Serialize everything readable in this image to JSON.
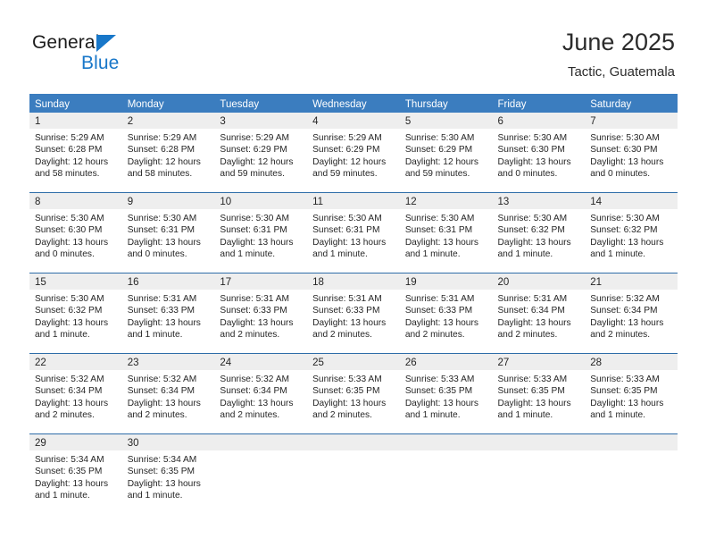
{
  "brand": {
    "name_top": "General",
    "name_bottom": "Blue",
    "triangle_icon": "triangle-logo-icon",
    "accent_color": "#1877c9"
  },
  "header": {
    "title": "June 2025",
    "subtitle": "Tactic, Guatemala"
  },
  "theme": {
    "header_bg": "#3b7dbf",
    "row_separator": "#2e6da8",
    "day_band_bg": "#eeeeee",
    "text_color": "#262626"
  },
  "calendar": {
    "weekday_headers": [
      "Sunday",
      "Monday",
      "Tuesday",
      "Wednesday",
      "Thursday",
      "Friday",
      "Saturday"
    ],
    "weeks": [
      [
        {
          "day": "1",
          "sunrise": "Sunrise: 5:29 AM",
          "sunset": "Sunset: 6:28 PM",
          "daylight_1": "Daylight: 12 hours",
          "daylight_2": "and 58 minutes."
        },
        {
          "day": "2",
          "sunrise": "Sunrise: 5:29 AM",
          "sunset": "Sunset: 6:28 PM",
          "daylight_1": "Daylight: 12 hours",
          "daylight_2": "and 58 minutes."
        },
        {
          "day": "3",
          "sunrise": "Sunrise: 5:29 AM",
          "sunset": "Sunset: 6:29 PM",
          "daylight_1": "Daylight: 12 hours",
          "daylight_2": "and 59 minutes."
        },
        {
          "day": "4",
          "sunrise": "Sunrise: 5:29 AM",
          "sunset": "Sunset: 6:29 PM",
          "daylight_1": "Daylight: 12 hours",
          "daylight_2": "and 59 minutes."
        },
        {
          "day": "5",
          "sunrise": "Sunrise: 5:30 AM",
          "sunset": "Sunset: 6:29 PM",
          "daylight_1": "Daylight: 12 hours",
          "daylight_2": "and 59 minutes."
        },
        {
          "day": "6",
          "sunrise": "Sunrise: 5:30 AM",
          "sunset": "Sunset: 6:30 PM",
          "daylight_1": "Daylight: 13 hours",
          "daylight_2": "and 0 minutes."
        },
        {
          "day": "7",
          "sunrise": "Sunrise: 5:30 AM",
          "sunset": "Sunset: 6:30 PM",
          "daylight_1": "Daylight: 13 hours",
          "daylight_2": "and 0 minutes."
        }
      ],
      [
        {
          "day": "8",
          "sunrise": "Sunrise: 5:30 AM",
          "sunset": "Sunset: 6:30 PM",
          "daylight_1": "Daylight: 13 hours",
          "daylight_2": "and 0 minutes."
        },
        {
          "day": "9",
          "sunrise": "Sunrise: 5:30 AM",
          "sunset": "Sunset: 6:31 PM",
          "daylight_1": "Daylight: 13 hours",
          "daylight_2": "and 0 minutes."
        },
        {
          "day": "10",
          "sunrise": "Sunrise: 5:30 AM",
          "sunset": "Sunset: 6:31 PM",
          "daylight_1": "Daylight: 13 hours",
          "daylight_2": "and 1 minute."
        },
        {
          "day": "11",
          "sunrise": "Sunrise: 5:30 AM",
          "sunset": "Sunset: 6:31 PM",
          "daylight_1": "Daylight: 13 hours",
          "daylight_2": "and 1 minute."
        },
        {
          "day": "12",
          "sunrise": "Sunrise: 5:30 AM",
          "sunset": "Sunset: 6:31 PM",
          "daylight_1": "Daylight: 13 hours",
          "daylight_2": "and 1 minute."
        },
        {
          "day": "13",
          "sunrise": "Sunrise: 5:30 AM",
          "sunset": "Sunset: 6:32 PM",
          "daylight_1": "Daylight: 13 hours",
          "daylight_2": "and 1 minute."
        },
        {
          "day": "14",
          "sunrise": "Sunrise: 5:30 AM",
          "sunset": "Sunset: 6:32 PM",
          "daylight_1": "Daylight: 13 hours",
          "daylight_2": "and 1 minute."
        }
      ],
      [
        {
          "day": "15",
          "sunrise": "Sunrise: 5:30 AM",
          "sunset": "Sunset: 6:32 PM",
          "daylight_1": "Daylight: 13 hours",
          "daylight_2": "and 1 minute."
        },
        {
          "day": "16",
          "sunrise": "Sunrise: 5:31 AM",
          "sunset": "Sunset: 6:33 PM",
          "daylight_1": "Daylight: 13 hours",
          "daylight_2": "and 1 minute."
        },
        {
          "day": "17",
          "sunrise": "Sunrise: 5:31 AM",
          "sunset": "Sunset: 6:33 PM",
          "daylight_1": "Daylight: 13 hours",
          "daylight_2": "and 2 minutes."
        },
        {
          "day": "18",
          "sunrise": "Sunrise: 5:31 AM",
          "sunset": "Sunset: 6:33 PM",
          "daylight_1": "Daylight: 13 hours",
          "daylight_2": "and 2 minutes."
        },
        {
          "day": "19",
          "sunrise": "Sunrise: 5:31 AM",
          "sunset": "Sunset: 6:33 PM",
          "daylight_1": "Daylight: 13 hours",
          "daylight_2": "and 2 minutes."
        },
        {
          "day": "20",
          "sunrise": "Sunrise: 5:31 AM",
          "sunset": "Sunset: 6:34 PM",
          "daylight_1": "Daylight: 13 hours",
          "daylight_2": "and 2 minutes."
        },
        {
          "day": "21",
          "sunrise": "Sunrise: 5:32 AM",
          "sunset": "Sunset: 6:34 PM",
          "daylight_1": "Daylight: 13 hours",
          "daylight_2": "and 2 minutes."
        }
      ],
      [
        {
          "day": "22",
          "sunrise": "Sunrise: 5:32 AM",
          "sunset": "Sunset: 6:34 PM",
          "daylight_1": "Daylight: 13 hours",
          "daylight_2": "and 2 minutes."
        },
        {
          "day": "23",
          "sunrise": "Sunrise: 5:32 AM",
          "sunset": "Sunset: 6:34 PM",
          "daylight_1": "Daylight: 13 hours",
          "daylight_2": "and 2 minutes."
        },
        {
          "day": "24",
          "sunrise": "Sunrise: 5:32 AM",
          "sunset": "Sunset: 6:34 PM",
          "daylight_1": "Daylight: 13 hours",
          "daylight_2": "and 2 minutes."
        },
        {
          "day": "25",
          "sunrise": "Sunrise: 5:33 AM",
          "sunset": "Sunset: 6:35 PM",
          "daylight_1": "Daylight: 13 hours",
          "daylight_2": "and 2 minutes."
        },
        {
          "day": "26",
          "sunrise": "Sunrise: 5:33 AM",
          "sunset": "Sunset: 6:35 PM",
          "daylight_1": "Daylight: 13 hours",
          "daylight_2": "and 1 minute."
        },
        {
          "day": "27",
          "sunrise": "Sunrise: 5:33 AM",
          "sunset": "Sunset: 6:35 PM",
          "daylight_1": "Daylight: 13 hours",
          "daylight_2": "and 1 minute."
        },
        {
          "day": "28",
          "sunrise": "Sunrise: 5:33 AM",
          "sunset": "Sunset: 6:35 PM",
          "daylight_1": "Daylight: 13 hours",
          "daylight_2": "and 1 minute."
        }
      ],
      [
        {
          "day": "29",
          "sunrise": "Sunrise: 5:34 AM",
          "sunset": "Sunset: 6:35 PM",
          "daylight_1": "Daylight: 13 hours",
          "daylight_2": "and 1 minute."
        },
        {
          "day": "30",
          "sunrise": "Sunrise: 5:34 AM",
          "sunset": "Sunset: 6:35 PM",
          "daylight_1": "Daylight: 13 hours",
          "daylight_2": "and 1 minute."
        },
        {
          "day": "",
          "sunrise": "",
          "sunset": "",
          "daylight_1": "",
          "daylight_2": ""
        },
        {
          "day": "",
          "sunrise": "",
          "sunset": "",
          "daylight_1": "",
          "daylight_2": ""
        },
        {
          "day": "",
          "sunrise": "",
          "sunset": "",
          "daylight_1": "",
          "daylight_2": ""
        },
        {
          "day": "",
          "sunrise": "",
          "sunset": "",
          "daylight_1": "",
          "daylight_2": ""
        },
        {
          "day": "",
          "sunrise": "",
          "sunset": "",
          "daylight_1": "",
          "daylight_2": ""
        }
      ]
    ]
  }
}
